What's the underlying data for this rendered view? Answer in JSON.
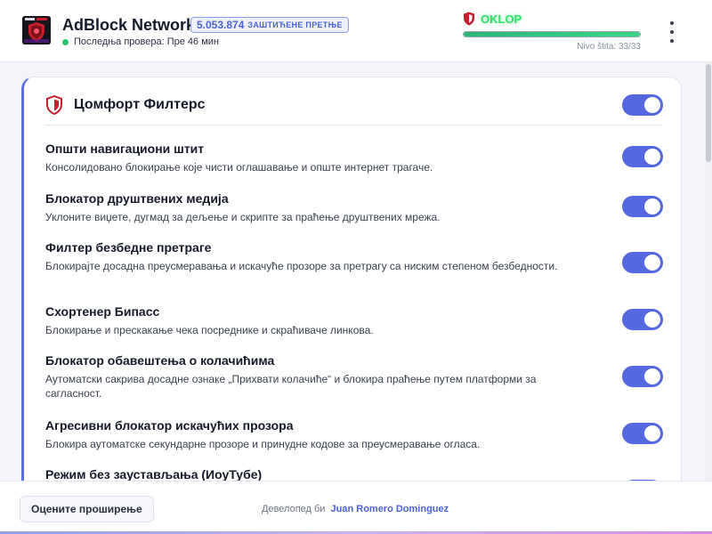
{
  "header": {
    "app_title": "AdBlock Network",
    "threat_count": "5.053.874",
    "threat_label": "ЗАШТИЋЕНЕ ПРЕТЊЕ",
    "last_check": "Последња провера: Пре 46 мин",
    "shield_status": "OKLOP",
    "shield_level": "Nivo štita: 33/33",
    "shield_progress": 1.0
  },
  "colors": {
    "accent": "#5468e0",
    "status_green": "#2ee06a",
    "check_dot": "#2cc56f",
    "shield_red": "#c81e2c"
  },
  "card": {
    "icon": "shield-icon",
    "title": "Цомфорт Филтерс",
    "master_toggle_on": true,
    "filters": [
      {
        "title": "Општи навигациони штит",
        "description": "Консолидовано блокирање које чисти оглашавање и опште интернет трагаче.",
        "enabled": true
      },
      {
        "title": "Блокатор друштвених медија",
        "description": "Уклоните виџете, дугмад за дељење и скрипте за праћење друштвених мрежа.",
        "enabled": true
      },
      {
        "title": "Филтер безбедне претраге",
        "description": "Блокирајте досадна преусмеравања и искачуће прозоре за претрагу са ниским степеном безбедности.",
        "enabled": true
      },
      {
        "title": "Схортенер Бипасс",
        "description": "Блокирање и прескакање чека посреднике и скраћиваче линкова.",
        "enabled": true
      },
      {
        "title": "Блокатор обавештења о колачићима",
        "description": "Аутоматски сакрива досадне ознаке „Прихвати колачиће“ и блокира праћење путем платформи за сагласност.",
        "enabled": true
      },
      {
        "title": "Агресивни блокатор искачућих прозора",
        "description": "Блокира аутоматске секундарне прозоре и принудне кодове за преусмеравање огласа.",
        "enabled": true
      },
      {
        "title": "Режим без заустављања (ИоуТубе)",
        "description": "",
        "enabled": true
      }
    ]
  },
  "footer": {
    "rate_button": "Оцените проширење",
    "developer_prefix": "Девелопед би",
    "developer_name": "Juan Romero Dominguez"
  }
}
